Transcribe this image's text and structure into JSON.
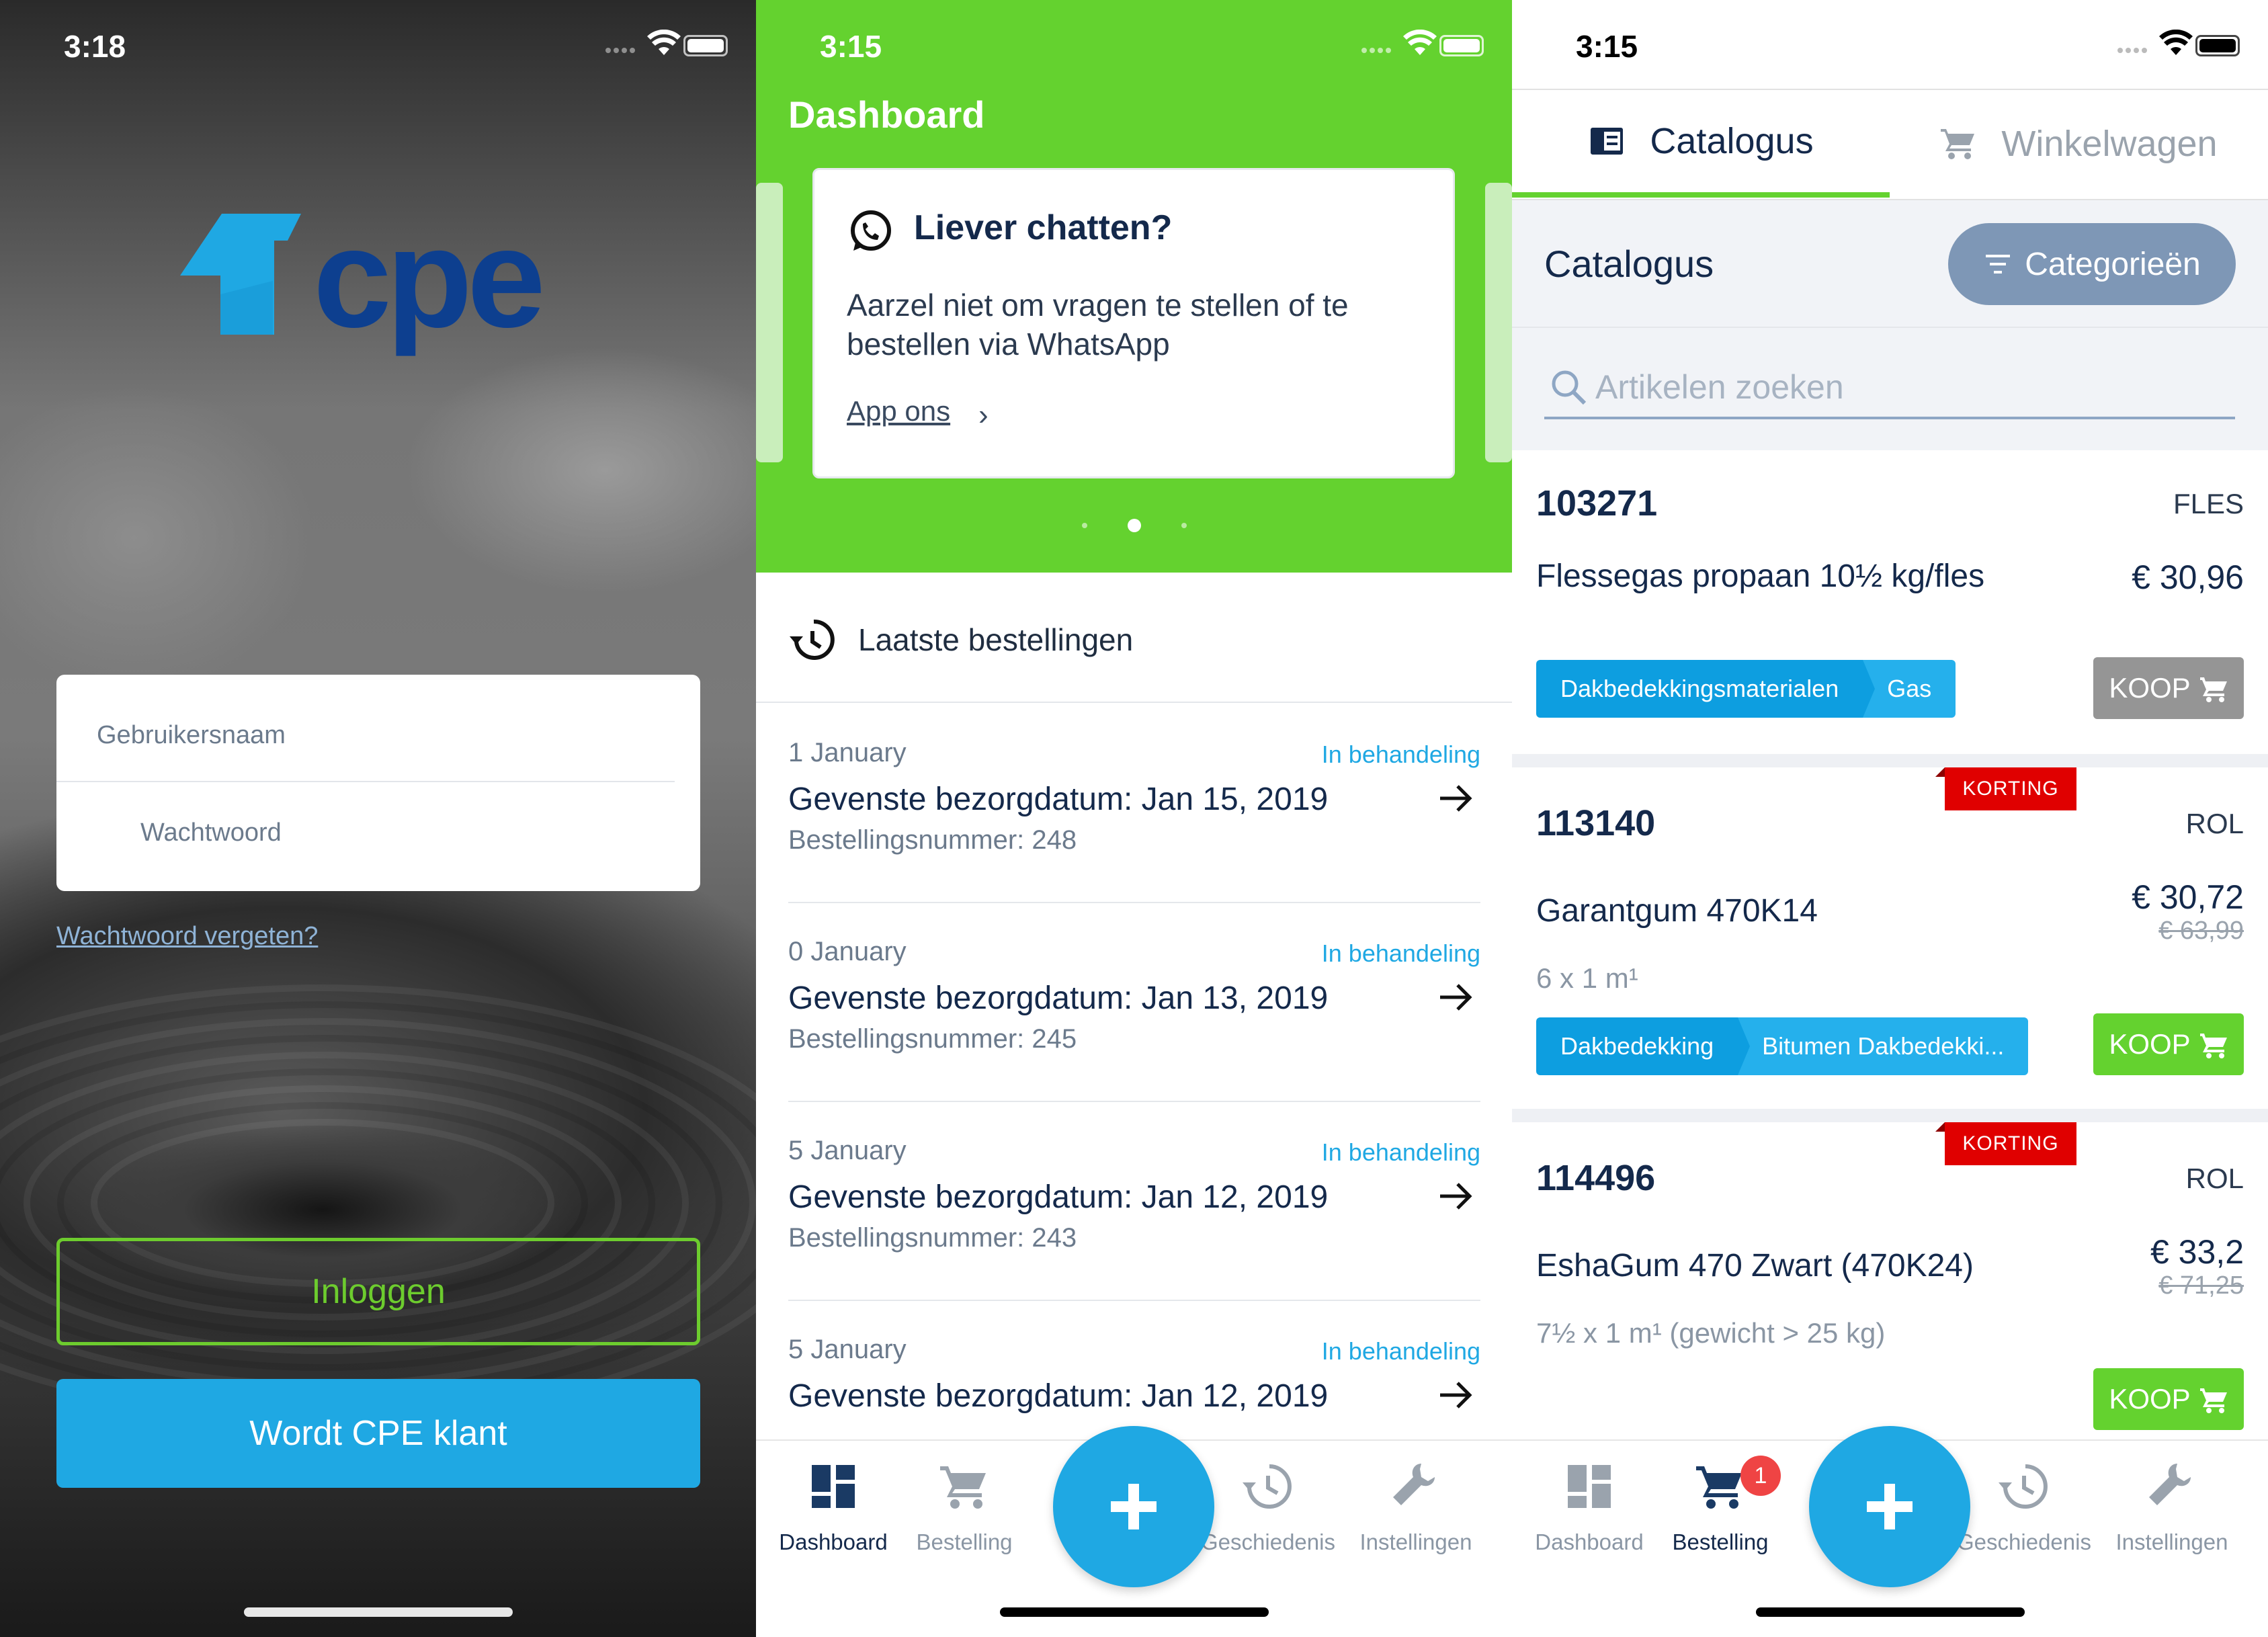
{
  "login_screen": {
    "status_time": "3:18",
    "logo_text": "cpe",
    "username_placeholder": "Gebruikersnaam",
    "password_placeholder": "Wachtwoord",
    "forgot_link": "Wachtwoord vergeten?",
    "login_button": "Inloggen",
    "register_button": "Wordt CPE klant"
  },
  "dashboard_screen": {
    "status_time": "3:15",
    "title": "Dashboard",
    "chat_card": {
      "title": "Liever chatten?",
      "body": "Aarzel niet om vragen te stellen of te bestellen via WhatsApp",
      "link": "App ons"
    },
    "carousel": {
      "count": 3,
      "active": 1
    },
    "recent_heading": "Laatste bestellingen",
    "orders": [
      {
        "date": "1 January",
        "status": "In behandeling",
        "delivery": "Gevenste bezorgdatum: Jan 15, 2019",
        "number": "Bestellingsnummer: 248"
      },
      {
        "date": "0 January",
        "status": "In behandeling",
        "delivery": "Gevenste bezorgdatum: Jan 13, 2019",
        "number": "Bestellingsnummer: 245"
      },
      {
        "date": "5 January",
        "status": "In behandeling",
        "delivery": "Gevenste bezorgdatum: Jan 12, 2019",
        "number": "Bestellingsnummer: 243"
      },
      {
        "date": "5 January",
        "status": "In behandeling",
        "delivery": "Gevenste bezorgdatum: Jan 12, 2019",
        "number": ""
      }
    ],
    "tabs": [
      {
        "label": "Dashboard",
        "icon": "dashboard-icon",
        "active": true
      },
      {
        "label": "Bestelling",
        "icon": "cart-icon",
        "active": false
      },
      {
        "label": "Geschiedenis",
        "icon": "history-icon",
        "active": false
      },
      {
        "label": "Instellingen",
        "icon": "wrench-icon",
        "active": false
      }
    ]
  },
  "catalog_screen": {
    "status_time": "3:15",
    "top_tabs": [
      {
        "label": "Catalogus",
        "icon": "catalog-icon",
        "active": true
      },
      {
        "label": "Winkelwagen",
        "icon": "cart-icon",
        "active": false
      }
    ],
    "heading": "Catalogus",
    "categories_button": "Categorieën",
    "search_placeholder": "Artikelen zoeken",
    "products": [
      {
        "code": "103271",
        "unit": "FLES",
        "name": "Flessegas propaan 10½ kg/fles",
        "price": "€ 30,96",
        "old_price": "",
        "quantity": "",
        "tags": [
          "Dakbedekkingsmaterialen",
          "Gas"
        ],
        "buy": "KOOP",
        "discount": ""
      },
      {
        "code": "113140",
        "unit": "ROL",
        "name": "Garantgum 470K14",
        "price": "€ 30,72",
        "old_price": "€ 63,99",
        "quantity": "6 x 1 m¹",
        "tags": [
          "Dakbedekking",
          "Bitumen Dakbedekki..."
        ],
        "buy": "KOOP",
        "discount": "KORTING"
      },
      {
        "code": "114496",
        "unit": "ROL",
        "name": "EshaGum 470 Zwart (470K24)",
        "price": "€ 33,2",
        "old_price": "€ 71,25",
        "quantity": "7½ x 1 m¹ (gewicht > 25 kg)",
        "tags": [],
        "buy": "KOOP",
        "discount": "KORTING"
      }
    ],
    "cart_badge": "1",
    "tabs": [
      {
        "label": "Dashboard",
        "icon": "dashboard-icon",
        "active": false
      },
      {
        "label": "Bestelling",
        "icon": "cart-icon",
        "active": true
      },
      {
        "label": "Geschiedenis",
        "icon": "history-icon",
        "active": false
      },
      {
        "label": "Instellingen",
        "icon": "wrench-icon",
        "active": false
      }
    ]
  },
  "colors": {
    "brand_green": "#64d22f",
    "brand_blue": "#1fa8e3",
    "navy": "#14294b",
    "discount_red": "#e00000",
    "tag_blue": "#0d9ee0",
    "category_button": "#7e97b6"
  }
}
